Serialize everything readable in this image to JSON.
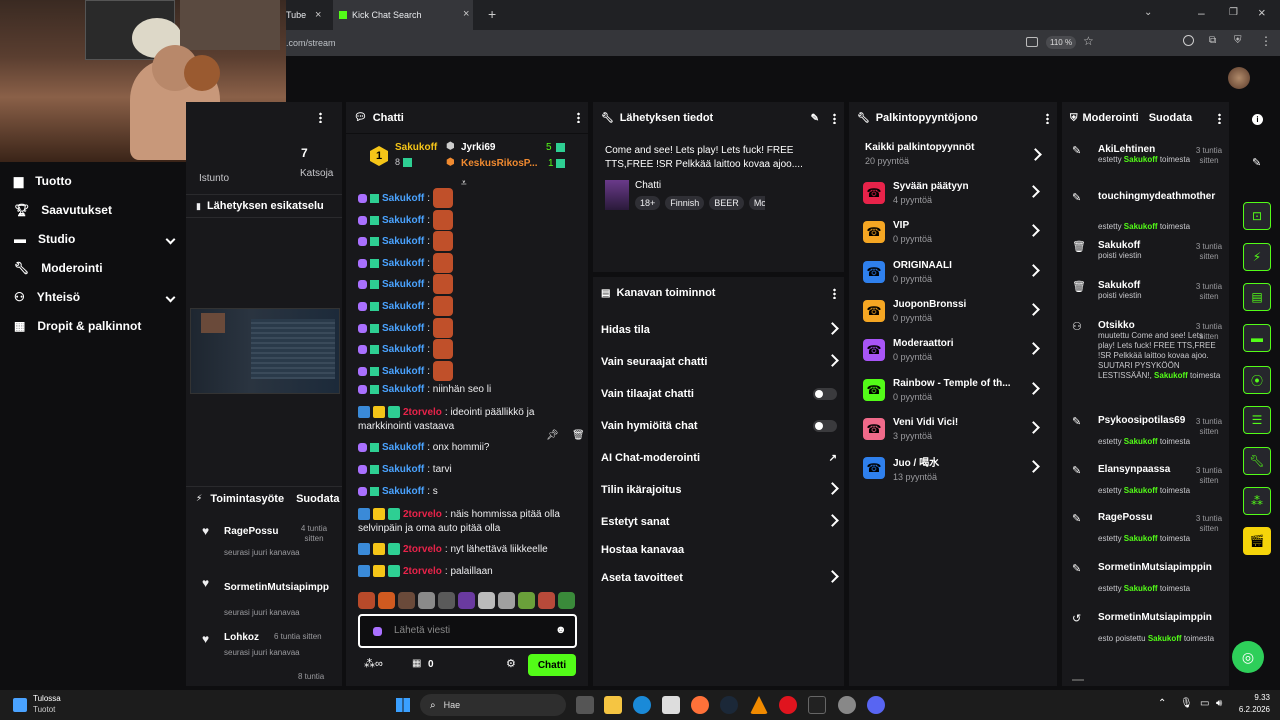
{
  "browser": {
    "tab1": "Tube",
    "tab2": "Kick Chat Search",
    "url": ".com/stream",
    "zoom": "110 %"
  },
  "webcam": {
    "label": "webcam-overlay"
  },
  "left": {
    "viewers": "7",
    "viewers_label": "Katsoja",
    "session": "Istunto",
    "preview_title": "Lähetyksen esikatselu",
    "nav": [
      "Tuotto",
      "Saavutukset",
      "Studio",
      "Moderointi",
      "Yhteisö",
      "Dropit & palkinnot"
    ],
    "activity_title": "Toimintasyöte",
    "activity_filter": "Suodata",
    "feed": [
      {
        "name": "RagePossu",
        "time": "4 tuntia sitten",
        "desc": "seurasi juuri kanavaa"
      },
      {
        "name": "SormetinMutsiapimpp",
        "time": "",
        "desc": "seurasi juuri kanavaa"
      },
      {
        "name": "Lohkoz",
        "time": "6 tuntia sitten",
        "desc": "seurasi juuri kanavaa"
      },
      {
        "name": "",
        "time": "8 tuntia",
        "desc": ""
      }
    ]
  },
  "chat": {
    "title": "Chatti",
    "leaderboard": [
      {
        "rank": "1",
        "name": "Sakukoff",
        "count": "8",
        "gifts": "5"
      },
      {
        "rank": "",
        "name": "Jyrki69",
        "count": "",
        "gifts": "5"
      },
      {
        "rank": "",
        "name": "KeskusRikosP...",
        "count": "",
        "gifts": "1"
      }
    ],
    "messages": [
      {
        "user": "Sakukoff",
        "text": ":",
        "type": "emote"
      },
      {
        "user": "Sakukoff",
        "text": ":",
        "type": "emote"
      },
      {
        "user": "Sakukoff",
        "text": ":",
        "type": "emote"
      },
      {
        "user": "Sakukoff",
        "text": ":",
        "type": "emote"
      },
      {
        "user": "Sakukoff",
        "text": ":",
        "type": "emote"
      },
      {
        "user": "Sakukoff",
        "text": ":",
        "type": "emote"
      },
      {
        "user": "Sakukoff",
        "text": ":",
        "type": "emote"
      },
      {
        "user": "Sakukoff",
        "text": ":",
        "type": "emote"
      },
      {
        "user": "Sakukoff",
        "text": ":",
        "type": "emote"
      },
      {
        "user": "Sakukoff",
        "text": ": niinhän seo li",
        "type": "text"
      },
      {
        "user": "2torvelo",
        "text": ": ideointi päällikkö ja",
        "text2": "markkinointi vastaava",
        "type": "text2"
      },
      {
        "user": "Sakukoff",
        "text": ": onx hommii?",
        "type": "text"
      },
      {
        "user": "Sakukoff",
        "text": ": tarvi",
        "type": "text"
      },
      {
        "user": "Sakukoff",
        "text": ": s",
        "type": "text"
      },
      {
        "user": "2torvelo",
        "text": ": näis hommissa pitää olla",
        "text2": "selvinpäin ja oma auto pitää olla",
        "type": "text2"
      },
      {
        "user": "2torvelo",
        "text": ": nyt lähettävä liikkeelle",
        "type": "text"
      },
      {
        "user": "2torvelo",
        "text": ": palaillaan",
        "type": "text"
      }
    ],
    "input_placeholder": "Lähetä viesti",
    "points": "0",
    "send": "Chatti"
  },
  "stream_info": {
    "title": "Lähetyksen tiedot",
    "stream_title": "Come and see! Lets play! Lets fuck! FREE TTS,FREE !SR Pelkkää laittoo kovaa ajoo....",
    "category": "Chatti",
    "tags": [
      "18+",
      "Finnish",
      "BEER",
      "Mo"
    ]
  },
  "channel_actions": {
    "title": "Kanavan toiminnot",
    "items": [
      "Hidas tila",
      "Vain seuraajat chatti",
      "Vain tilaajat chatti",
      "Vain hymiöitä chat",
      "AI Chat-moderointi",
      "Tilin ikärajoitus",
      "Estetyt sanat",
      "Hostaa kanavaa",
      "Aseta tavoitteet"
    ]
  },
  "rewards": {
    "title": "Palkintopyyntöjono",
    "all": "Kaikki palkintopyynnöt",
    "all_count": "20 pyyntöä",
    "items": [
      {
        "name": "Syvään päätyyn",
        "count": "4 pyyntöä",
        "color": "#e8234a"
      },
      {
        "name": "VIP",
        "count": "0 pyyntöä",
        "color": "#f5a623"
      },
      {
        "name": "ORIGINAALI",
        "count": "0 pyyntöä",
        "color": "#2f80ed"
      },
      {
        "name": "JuoponBronssi",
        "count": "0 pyyntöä",
        "color": "#f5a623"
      },
      {
        "name": "Moderaattori",
        "count": "0 pyyntöä",
        "color": "#a855f7"
      },
      {
        "name": "Rainbow - Temple of th...",
        "count": "0 pyyntöä",
        "color": "#53fc18"
      },
      {
        "name": "Veni Vidi Vici!",
        "count": "3 pyyntöä",
        "color": "#f06a8a"
      },
      {
        "name": "Juo / 喝水",
        "count": "13 pyyntöä",
        "color": "#2f80ed"
      }
    ]
  },
  "moderation": {
    "title": "Moderointi",
    "filter": "Suodata",
    "items": [
      {
        "name": "AkiLehtinen",
        "time": "3 tuntia sitten",
        "desc_pre": "estetty ",
        "mod": "Sakukoff",
        "desc_post": " toimesta"
      },
      {
        "name": "touchingmydeathmother",
        "time": "",
        "desc_pre": "estetty ",
        "mod": "Sakukoff",
        "desc_post": " toimesta"
      },
      {
        "name": "Sakukoff",
        "time": "3 tuntia sitten",
        "desc_pre": "poisti viestin",
        "mod": "",
        "desc_post": ""
      },
      {
        "name": "Sakukoff",
        "time": "3 tuntia sitten",
        "desc_pre": "poisti viestin",
        "mod": "",
        "desc_post": ""
      },
      {
        "name": "Otsikko",
        "time": "3 tuntia sitten",
        "desc_pre": "muutettu Come and see! Lets play! Lets fuck! FREE TTS,FREE !SR Pelkkää laittoo kovaa ajoo. SUUTARI PYSYKÖÖN LESTISSÄÄN!, ",
        "mod": "Sakukoff",
        "desc_post": " toimesta"
      },
      {
        "name": "Psykoosipotilas69",
        "time": "3 tuntia sitten",
        "desc_pre": "estetty ",
        "mod": "Sakukoff",
        "desc_post": " toimesta"
      },
      {
        "name": "Elansynpaassa",
        "time": "3 tuntia sitten",
        "desc_pre": "estetty ",
        "mod": "Sakukoff",
        "desc_post": " toimesta"
      },
      {
        "name": "RagePossu",
        "time": "3 tuntia sitten",
        "desc_pre": "estetty ",
        "mod": "Sakukoff",
        "desc_post": " toimesta"
      },
      {
        "name": "SormetinMutsiapimppin",
        "time": "",
        "desc_pre": "estetty ",
        "mod": "Sakukoff",
        "desc_post": " toimesta"
      },
      {
        "name": "SormetinMutsiapimppin",
        "time": "",
        "desc_pre": "esto poistettu ",
        "mod": "Sakukoff",
        "desc_post": " toimesta"
      }
    ]
  },
  "taskbar": {
    "weather_title": "Tulossa",
    "weather_sub": "Tuotot",
    "search": "Hae",
    "time": "9.33",
    "date": "6.2.2026"
  }
}
